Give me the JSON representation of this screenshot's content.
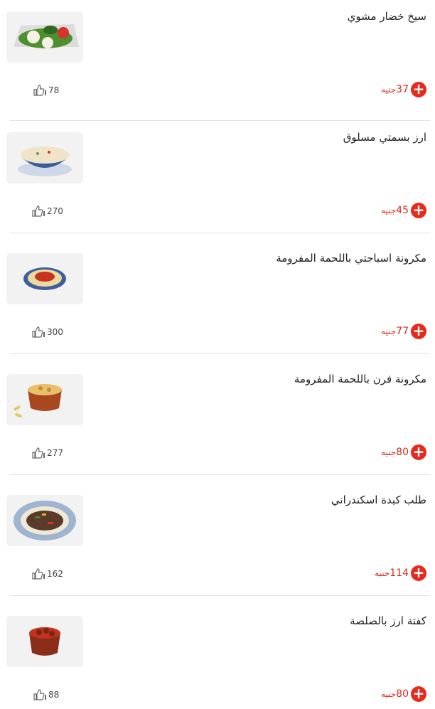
{
  "items": [
    {
      "title": "سيخ خضار مشوي",
      "price": "37",
      "currency": "جنيه",
      "likes": "78",
      "thumb_icon": "grilled-vegetables-image"
    },
    {
      "title": "ارز بسمتي مسلوق",
      "price": "45",
      "currency": "جنيه",
      "likes": "270",
      "thumb_icon": "basmati-rice-image"
    },
    {
      "title": "مكرونة اسباجتي باللحمة المفرومة",
      "price": "77",
      "currency": "جنيه",
      "likes": "300",
      "thumb_icon": "spaghetti-image"
    },
    {
      "title": "مكرونة فرن باللحمة المفرومة",
      "price": "80",
      "currency": "جنيه",
      "likes": "277",
      "thumb_icon": "baked-pasta-image"
    },
    {
      "title": "طلب كبدة اسكندراني",
      "price": "114",
      "currency": "جنيه",
      "likes": "162",
      "thumb_icon": "liver-dish-image"
    },
    {
      "title": "كفتة ارز بالصلصة",
      "price": "80",
      "currency": "جنيه",
      "likes": "88",
      "thumb_icon": "kofta-sauce-image"
    }
  ],
  "colors": {
    "accent": "#e8291b",
    "price_text": "#d62a1c",
    "divider": "#e3e3e3"
  }
}
